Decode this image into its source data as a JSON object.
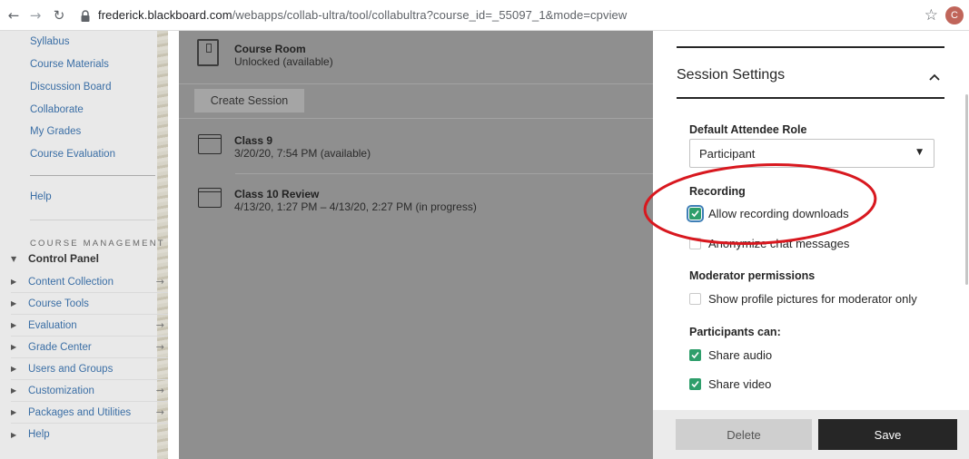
{
  "browser": {
    "url_host": "frederick.blackboard.com",
    "url_path": "/webapps/collab-ultra/tool/collabultra?course_id=_55097_1&mode=cpview",
    "profile_initial": "C"
  },
  "course_menu": {
    "links": [
      "Syllabus",
      "Course Materials",
      "Discussion Board",
      "Collaborate",
      "My Grades",
      "Course Evaluation"
    ],
    "help_label": "Help",
    "management_title": "COURSE MANAGEMENT",
    "control_panel_label": "Control Panel",
    "control_panel_items": [
      {
        "label": "Content Collection",
        "arrow": "→"
      },
      {
        "label": "Course Tools",
        "arrow": ""
      },
      {
        "label": "Evaluation",
        "arrow": "→"
      },
      {
        "label": "Grade Center",
        "arrow": "→"
      },
      {
        "label": "Users and Groups",
        "arrow": ""
      },
      {
        "label": "Customization",
        "arrow": "→"
      },
      {
        "label": "Packages and Utilities",
        "arrow": "→"
      },
      {
        "label": "Help",
        "arrow": ""
      }
    ]
  },
  "sessions": {
    "course_room_title": "Course Room",
    "course_room_status": "Unlocked (available)",
    "create_session_label": "Create Session",
    "items": [
      {
        "title": "Class 9",
        "time": "3/20/20, 7:54 PM (available)"
      },
      {
        "title": "Class 10 Review",
        "time": "4/13/20, 1:27 PM – 4/13/20, 2:27 PM (in progress)"
      }
    ]
  },
  "settings": {
    "panel_title": "Session Settings",
    "default_role_label": "Default Attendee Role",
    "default_role_value": "Participant",
    "recording_label": "Recording",
    "allow_downloads_label": "Allow recording downloads",
    "anonymize_label": "Anonymize chat messages",
    "moderator_permissions_label": "Moderator permissions",
    "profile_pictures_label": "Show profile pictures for moderator only",
    "participants_can_label": "Participants can:",
    "share_audio_label": "Share audio",
    "share_video_label": "Share video",
    "delete_label": "Delete",
    "save_label": "Save",
    "checkbox_states": {
      "allow_downloads": true,
      "anonymize": false,
      "profile_pictures": false,
      "share_audio": true,
      "share_video": true
    }
  },
  "colors": {
    "checked_green": "#2e9e6b",
    "annotation_red": "#d8181f",
    "save_button": "#262626"
  }
}
